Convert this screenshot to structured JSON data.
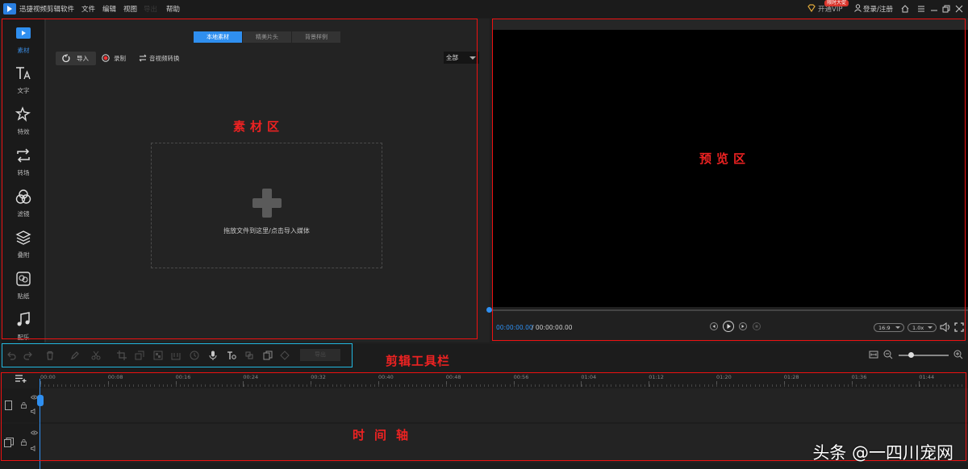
{
  "app": {
    "title": "迅捷视频剪辑软件",
    "menu": [
      "文件",
      "编辑",
      "视图",
      "帮助"
    ],
    "dim_menu": "导出",
    "vip_badge": "限时大促",
    "vip_label": "开通VIP",
    "login_label": "登录/注册"
  },
  "sidebar": {
    "items": [
      {
        "label": "素材",
        "icon": "media-icon",
        "active": true
      },
      {
        "label": "文字",
        "icon": "text-icon"
      },
      {
        "label": "特效",
        "icon": "effects-icon"
      },
      {
        "label": "转场",
        "icon": "transition-icon"
      },
      {
        "label": "滤镜",
        "icon": "filter-icon"
      },
      {
        "label": "叠附",
        "icon": "overlay-icon"
      },
      {
        "label": "贴纸",
        "icon": "sticker-icon"
      },
      {
        "label": "配乐",
        "icon": "music-icon"
      }
    ]
  },
  "material": {
    "tabs": [
      "本地素材",
      "精美片头",
      "背景样例"
    ],
    "import_label": "导入",
    "record_label": "录制",
    "convert_label": "音视频转换",
    "filter_value": "全部",
    "drop_hint": "拖放文件到这里/点击导入媒体"
  },
  "preview": {
    "time_current": "00:00:00.00",
    "time_total": "/ 00:00:00.00",
    "aspect": "16:9",
    "speed": "1.0x"
  },
  "toolbar": {
    "export_label": "导出"
  },
  "timeline": {
    "ticks": [
      "00:00",
      "00:08",
      "00:16",
      "00:24",
      "00:32",
      "00:40",
      "00:48",
      "00:56",
      "01:04",
      "01:12",
      "01:20",
      "01:28",
      "01:36",
      "01:44"
    ]
  },
  "annotations": {
    "material_area": "素材区",
    "preview_area": "预览区",
    "toolbar_area": "剪辑工具栏",
    "timeline_area": "时间轴"
  },
  "watermark": "头条 @一四川宠网",
  "colors": {
    "accent": "#2f8ff0",
    "annotation_red": "#e11111",
    "annotation_cyan": "#22b8e0"
  }
}
